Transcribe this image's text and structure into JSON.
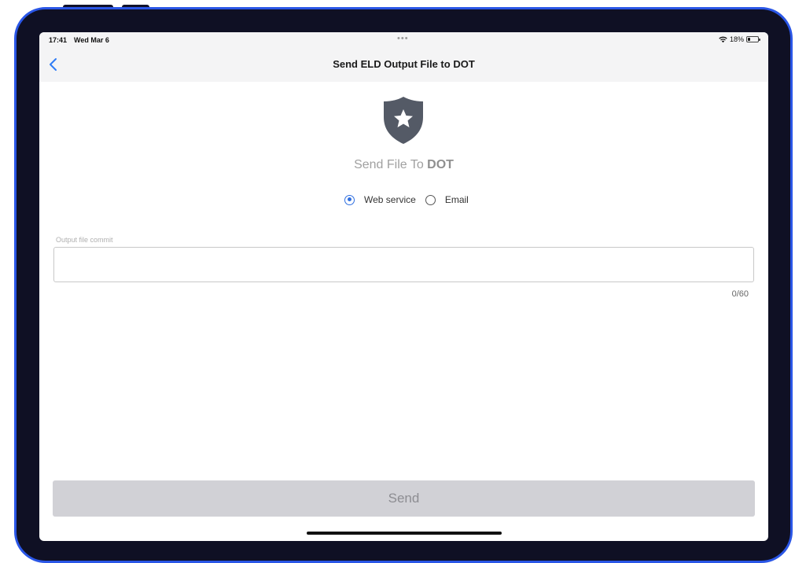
{
  "status_bar": {
    "time": "17:41",
    "date": "Wed Mar 6",
    "dots": "•••",
    "battery": "18%"
  },
  "nav": {
    "title": "Send ELD Output File to DOT"
  },
  "header": {
    "text_prefix": "Send File To ",
    "text_bold": "DOT"
  },
  "delivery": {
    "options": [
      {
        "label": "Web service",
        "selected": true
      },
      {
        "label": "Email",
        "selected": false
      }
    ]
  },
  "commit_field": {
    "label": "Output file commit",
    "value": "",
    "counter": "0/60"
  },
  "send_button": {
    "label": "Send"
  },
  "colors": {
    "accent": "#2f6fe0",
    "frame_border": "#2a56e6",
    "shield": "#545a66",
    "disabled_button": "#d1d1d6"
  }
}
